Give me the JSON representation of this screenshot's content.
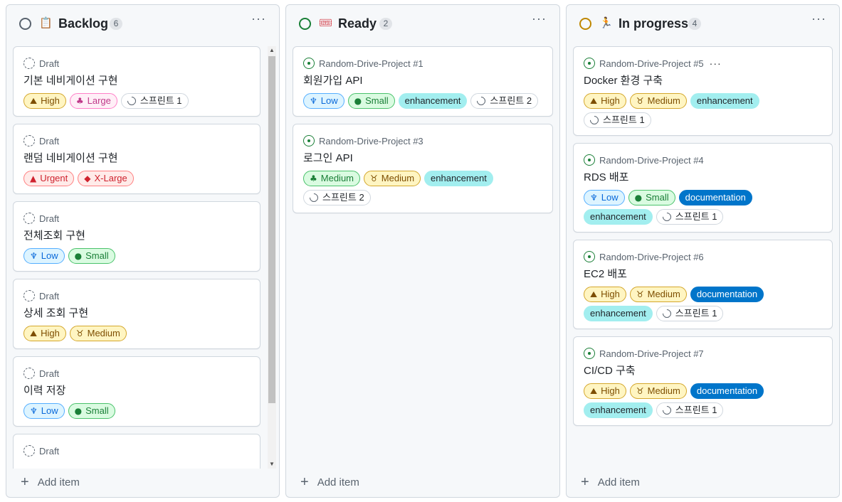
{
  "columns": {
    "backlog": {
      "title": "Backlog",
      "emoji": "📋",
      "count": "6",
      "color": "#59636e",
      "add_item": "Add item"
    },
    "ready": {
      "title": "Ready",
      "emoji": "🎟",
      "count": "2",
      "color": "#1a7f37",
      "add_item": "Add item"
    },
    "progress": {
      "title": "In progress",
      "emoji": "🏃",
      "count": "4",
      "color": "#bf8700",
      "add_item": "Add item"
    }
  },
  "backlog_cards": [
    {
      "head": "Draft",
      "title": "기본 네비게이션 구현",
      "labels": [
        "High",
        "Large",
        "스프린트 1"
      ]
    },
    {
      "head": "Draft",
      "title": "랜덤 네비게이션 구현",
      "labels": [
        "Urgent",
        "X-Large"
      ]
    },
    {
      "head": "Draft",
      "title": "전체조회 구현",
      "labels": [
        "Low",
        "Small"
      ]
    },
    {
      "head": "Draft",
      "title": "상세 조회 구현",
      "labels": [
        "High",
        "Medium"
      ]
    },
    {
      "head": "Draft",
      "title": "이력 저장",
      "labels": [
        "Low",
        "Small"
      ]
    },
    {
      "head": "Draft"
    }
  ],
  "ready_cards": [
    {
      "head": "Random-Drive-Project #1",
      "title": "회원가입 API",
      "labels": [
        "Low",
        "Small",
        "enhancement",
        "스프린트 2"
      ]
    },
    {
      "head": "Random-Drive-Project #3",
      "title": "로그인 API",
      "labels": [
        "Medium",
        "Medium",
        "enhancement",
        "스프린트 2"
      ]
    }
  ],
  "progress_cards": [
    {
      "head": "Random-Drive-Project #5",
      "title": "Docker 환경 구축",
      "labels": [
        "High",
        "Medium",
        "enhancement",
        "스프린트 1"
      ]
    },
    {
      "head": "Random-Drive-Project #4",
      "title": "RDS 배포",
      "labels": [
        "Low",
        "Small",
        "documentation",
        "enhancement",
        "스프린트 1"
      ]
    },
    {
      "head": "Random-Drive-Project #6",
      "title": "EC2 배포",
      "labels": [
        "High",
        "Medium",
        "documentation",
        "enhancement",
        "스프린트 1"
      ]
    },
    {
      "head": "Random-Drive-Project #7",
      "title": "CI/CD 구축",
      "labels": [
        "High",
        "Medium",
        "documentation",
        "enhancement",
        "스프린트 1"
      ]
    }
  ],
  "icons": {
    "high": "mountain-icon",
    "large": "octopus-icon",
    "urgent": "volcano-icon",
    "xlarge": "whale-icon",
    "low": "palm-tree-icon",
    "small": "rabbit-icon",
    "medium_size": "ox-icon",
    "medium_priority": "tree-icon",
    "iteration": "iteration-icon"
  }
}
